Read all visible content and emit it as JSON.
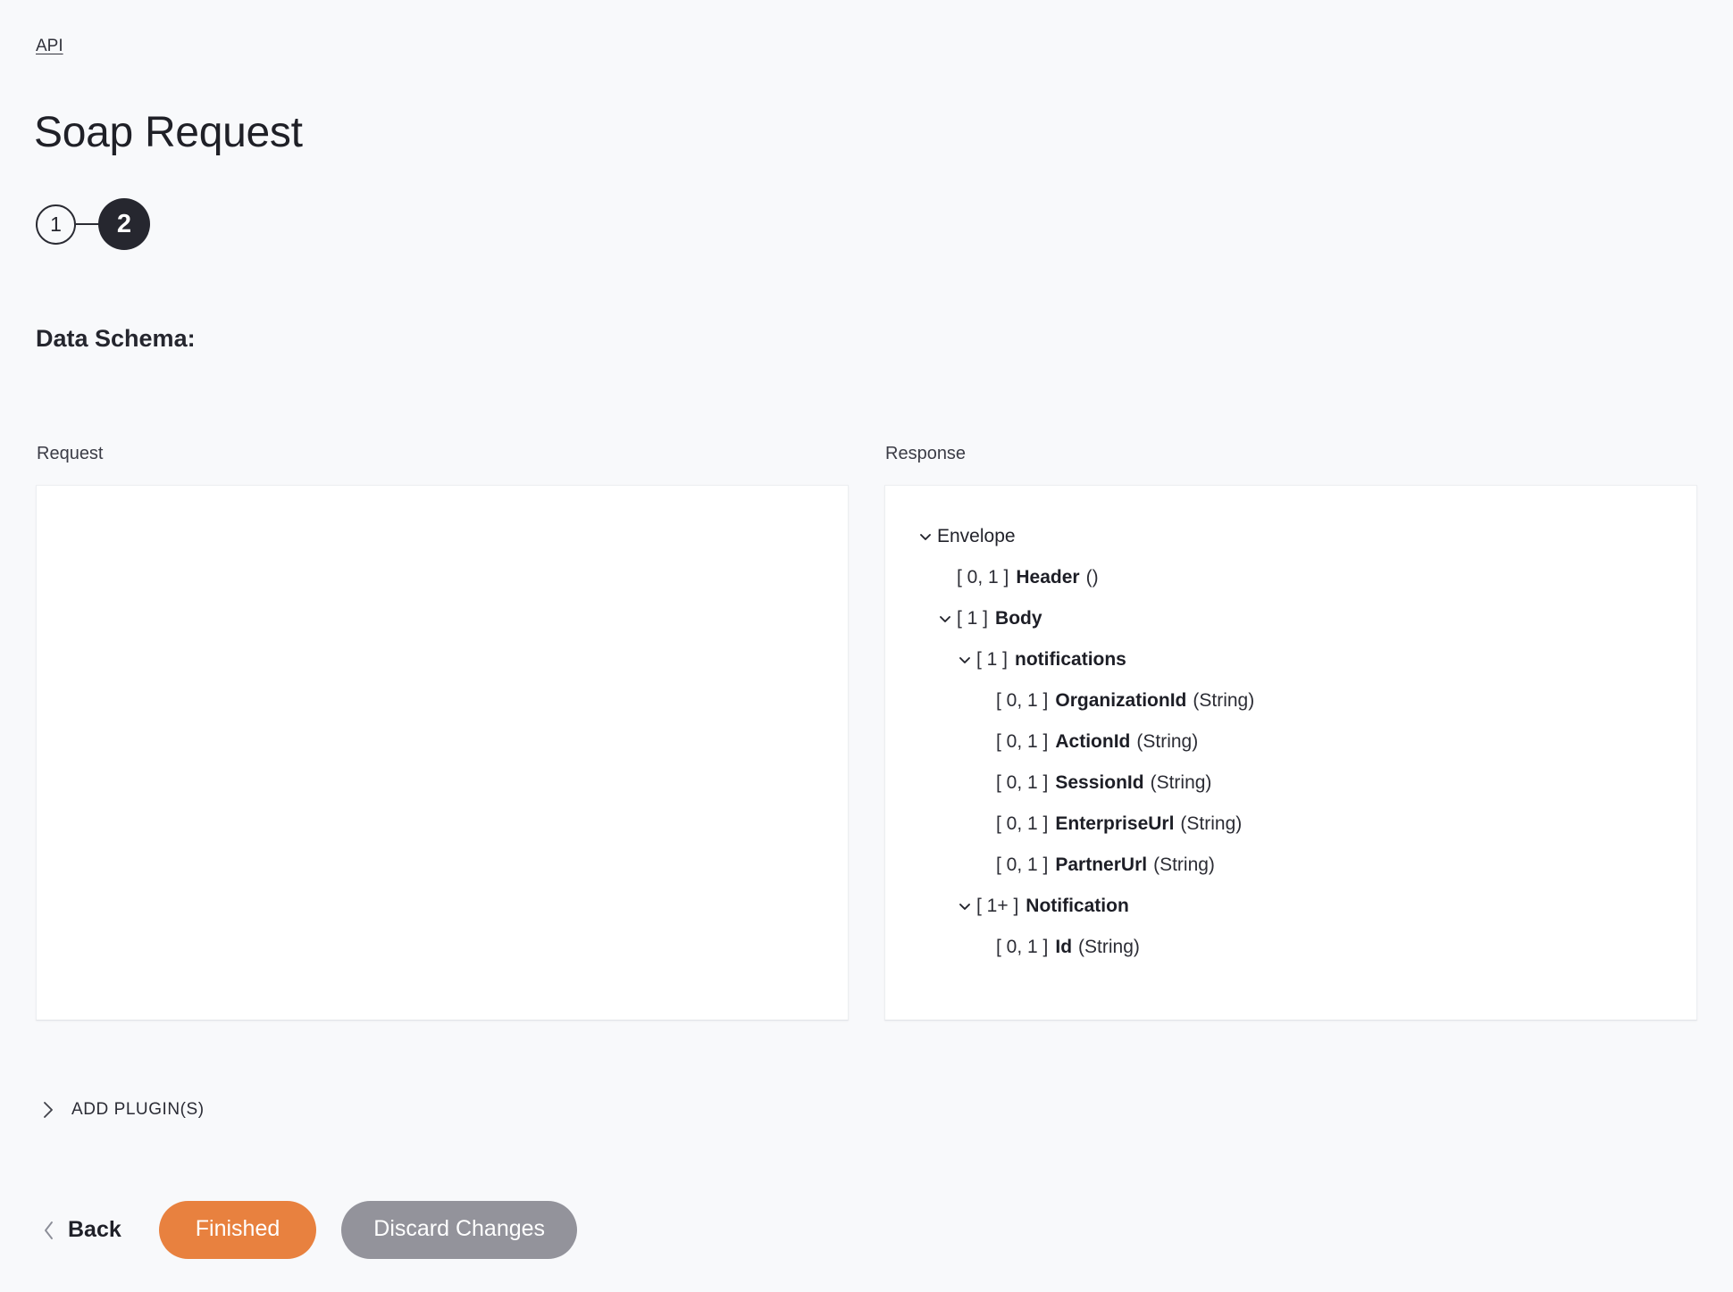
{
  "breadcrumb": {
    "label": "API"
  },
  "header": {
    "title": "Soap Request"
  },
  "stepper": {
    "steps": [
      {
        "label": "1",
        "state": "inactive"
      },
      {
        "label": "2",
        "state": "active"
      }
    ]
  },
  "schema": {
    "heading": "Data Schema:",
    "request": {
      "label": "Request",
      "nodes": []
    },
    "response": {
      "label": "Response",
      "nodes": [
        {
          "depth": 0,
          "twisty": "chevron-down-icon",
          "card": "",
          "name": "",
          "plain": "Envelope",
          "type": ""
        },
        {
          "depth": 1,
          "twisty": "none",
          "card": "[ 0, 1 ]",
          "name": "Header",
          "plain": "",
          "type": "()"
        },
        {
          "depth": 1,
          "twisty": "chevron-down-icon",
          "card": "[ 1 ]",
          "name": "Body",
          "plain": "",
          "type": ""
        },
        {
          "depth": 2,
          "twisty": "chevron-down-icon",
          "card": "[ 1 ]",
          "name": "notifications",
          "plain": "",
          "type": ""
        },
        {
          "depth": 3,
          "twisty": "none",
          "card": "[ 0, 1 ]",
          "name": "OrganizationId",
          "plain": "",
          "type": "(String)"
        },
        {
          "depth": 3,
          "twisty": "none",
          "card": "[ 0, 1 ]",
          "name": "ActionId",
          "plain": "",
          "type": "(String)"
        },
        {
          "depth": 3,
          "twisty": "none",
          "card": "[ 0, 1 ]",
          "name": "SessionId",
          "plain": "",
          "type": "(String)"
        },
        {
          "depth": 3,
          "twisty": "none",
          "card": "[ 0, 1 ]",
          "name": "EnterpriseUrl",
          "plain": "",
          "type": "(String)"
        },
        {
          "depth": 3,
          "twisty": "none",
          "card": "[ 0, 1 ]",
          "name": "PartnerUrl",
          "plain": "",
          "type": "(String)"
        },
        {
          "depth": 2,
          "twisty": "chevron-down-icon",
          "card": "[ 1+ ]",
          "name": "Notification",
          "plain": "",
          "type": ""
        },
        {
          "depth": 3,
          "twisty": "none",
          "card": "[ 0, 1 ]",
          "name": "Id",
          "plain": "",
          "type": "(String)"
        }
      ]
    }
  },
  "add_plugins": {
    "label": "ADD PLUGIN(S)",
    "icon": "chevron-right-icon"
  },
  "footer": {
    "back_label": "Back",
    "back_icon": "chevron-left-icon",
    "finished_label": "Finished",
    "discard_label": "Discard Changes"
  },
  "colors": {
    "accent": "#e8813f",
    "secondary": "#93939b",
    "step_active": "#26272f",
    "page_bg": "#f8f9fb",
    "panel_bg": "#ffffff"
  }
}
